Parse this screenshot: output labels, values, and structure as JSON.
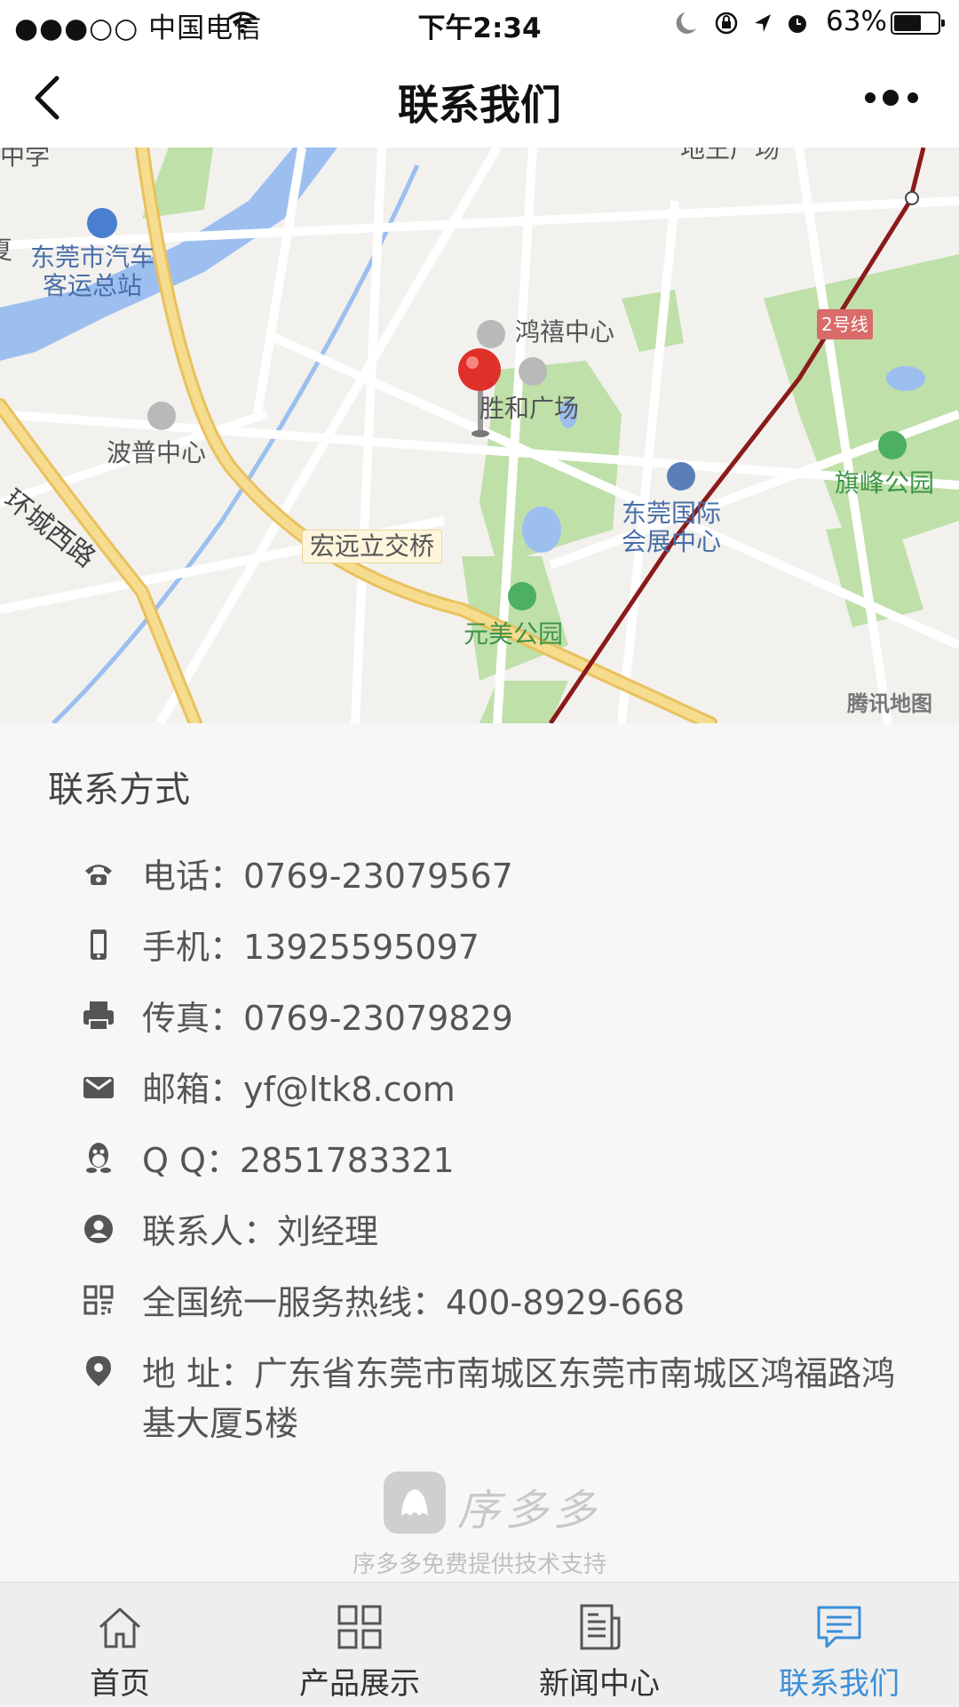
{
  "status_bar": {
    "carrier": "●●●○○ 中国电信",
    "time": "下午2:34",
    "battery": "63%",
    "battery_level": 0.63
  },
  "nav": {
    "title": "联系我们",
    "back_icon": "chevron-left-icon",
    "more_icon": "more-dots-icon"
  },
  "map": {
    "labels": {
      "station": "东莞市汽车\n客运总站",
      "hongxi": "鸿禧中心",
      "shenghe": "胜和广场",
      "bopu": "波普中心",
      "huancheng": "环城西路",
      "hongyuan": "宏远立交桥",
      "expo": "东莞国际\n会展中心",
      "qifeng": "旗峰公园",
      "yuanmei": "元美公园",
      "line2": "2号线",
      "watermark": "腾讯地图",
      "top_left": "中学",
      "top_center": "地王广场",
      "left_edge": "夏"
    }
  },
  "contact": {
    "title": "联系方式",
    "rows": [
      {
        "icon": "phone-icon",
        "text": "电话：0769-23079567"
      },
      {
        "icon": "mobile-icon",
        "text": "手机：13925595097"
      },
      {
        "icon": "fax-icon",
        "text": "传真：0769-23079829"
      },
      {
        "icon": "mail-icon",
        "text": "邮箱：yf@ltk8.com"
      },
      {
        "icon": "qq-icon",
        "text": "Q Q：2851783321"
      },
      {
        "icon": "user-icon",
        "text": "联系人：刘经理"
      },
      {
        "icon": "hotline-icon",
        "text": "全国统一服务热线：400-8929-668"
      },
      {
        "icon": "location-icon",
        "text": "地 址：广东省东莞市南城区东莞市南城区鸿福路鸿基大厦5楼"
      }
    ]
  },
  "brand": {
    "name": "序多多",
    "support": "序多多免费提供技术支持"
  },
  "tabs": [
    {
      "label": "首页",
      "icon": "home-icon",
      "active": false
    },
    {
      "label": "产品展示",
      "icon": "grid-icon",
      "active": false
    },
    {
      "label": "新闻中心",
      "icon": "news-icon",
      "active": false
    },
    {
      "label": "联系我们",
      "icon": "chat-icon",
      "active": true
    }
  ],
  "colors": {
    "accent": "#3b8fd9",
    "pin": "#e0302a",
    "metro_line": "#8b1a1a",
    "road_main": "#f3d27a",
    "river": "#9cbff0",
    "park": "#bfe0a8"
  }
}
